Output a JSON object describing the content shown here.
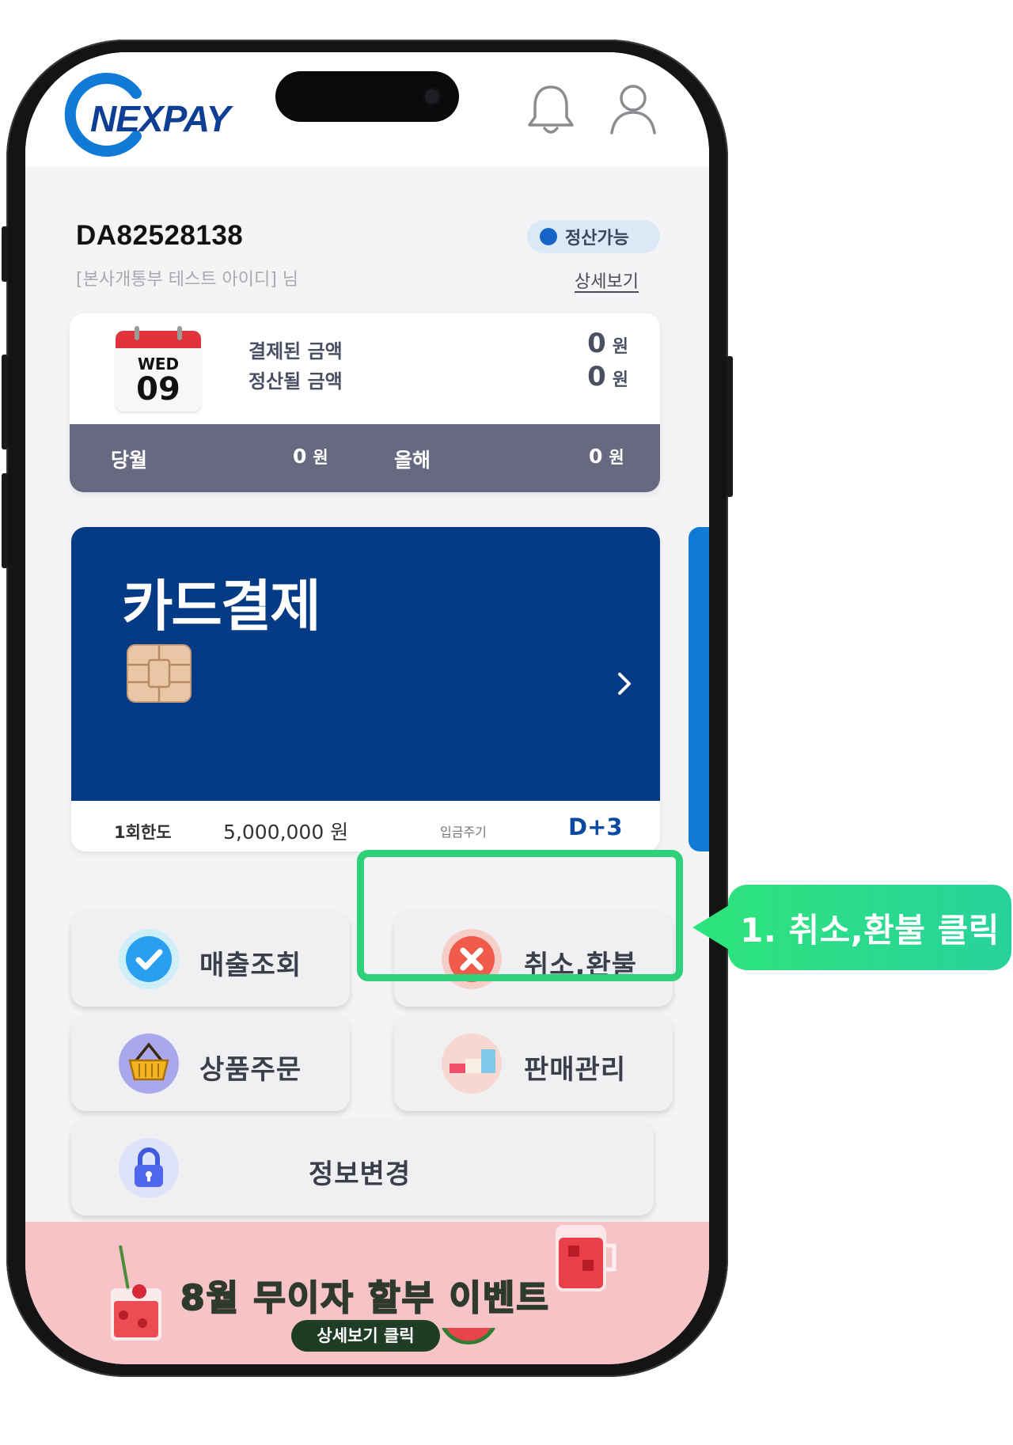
{
  "header": {
    "logo_text": "NEXPAY",
    "logo_icon": "nexpay-c-logo",
    "bell_icon": "bell-icon",
    "profile_icon": "user-icon"
  },
  "account": {
    "id": "DA82528138",
    "name": "[본사개통부 테스트 아이디] 님",
    "status": "정산가능",
    "detail_link": "상세보기"
  },
  "summary": {
    "calendar_day": "WED",
    "calendar_date": "09",
    "paid_label": "결제된 금액",
    "paid_value": "0",
    "settle_label": "정산될 금액",
    "settle_value": "0",
    "currency": "원",
    "month_label": "당월",
    "month_value": "0",
    "year_label": "올해",
    "year_value": "0"
  },
  "card": {
    "title": "카드결제",
    "limit_label": "1회한도",
    "limit_value": "5,000,000 원",
    "cycle_label": "입금주기",
    "cycle_value": "D+3",
    "arrow_icon": "chevron-right-icon",
    "chip_icon": "card-chip-icon"
  },
  "menu": {
    "sales": "매출조회",
    "cancel": "취소,환불",
    "order": "상품주문",
    "manage": "판매관리",
    "info": "정보변경"
  },
  "callout": {
    "text": "1. 취소,환불 클릭",
    "accent": "#2ed17a"
  },
  "banner": {
    "title": "8월 무이자 할부 이벤트",
    "button": "상세보기 클릭",
    "bg": "#f6c3c6"
  },
  "colors": {
    "brand": "#0e3f95",
    "card": "#053a84",
    "summary_bar": "#676980"
  }
}
